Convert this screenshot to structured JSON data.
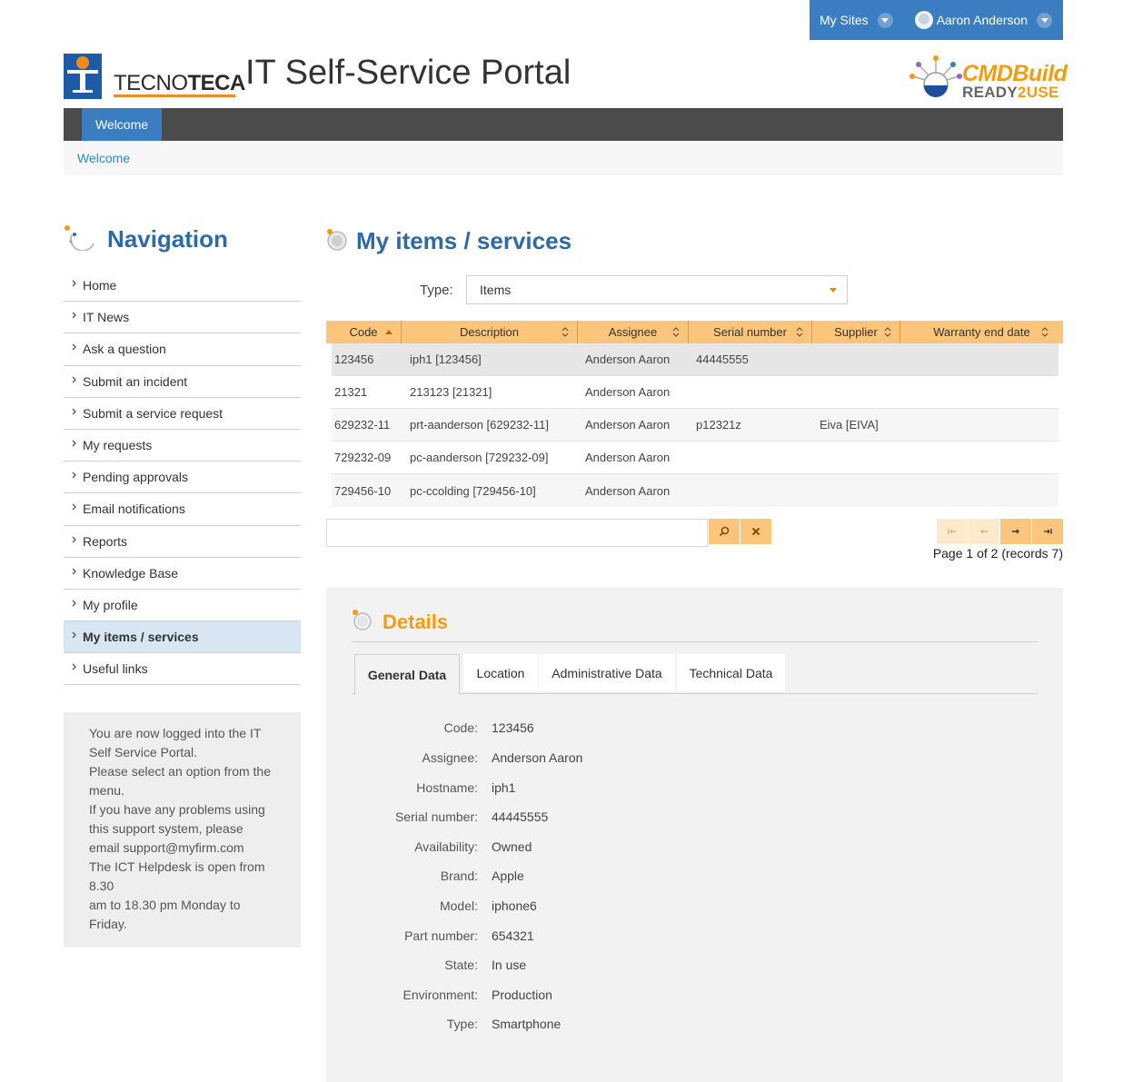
{
  "topbar": {
    "my_sites": "My Sites",
    "user_name": "Aaron Anderson"
  },
  "header": {
    "logo_text_a": "TECNO",
    "logo_text_b": "TECA",
    "portal_title": "IT Self-Service Portal",
    "cmdbuild_title": "CMDBuild",
    "cmdbuild_sub_a": "READY",
    "cmdbuild_sub_b": "2USE"
  },
  "navbar": {
    "active_tab": "Welcome"
  },
  "breadcrumb": "Welcome",
  "sidebar": {
    "title": "Navigation",
    "items": [
      {
        "label": "Home"
      },
      {
        "label": "IT News"
      },
      {
        "label": "Ask a question"
      },
      {
        "label": "Submit an incident"
      },
      {
        "label": "Submit a service request"
      },
      {
        "label": "My requests"
      },
      {
        "label": "Pending approvals"
      },
      {
        "label": "Email notifications"
      },
      {
        "label": "Reports"
      },
      {
        "label": "Knowledge Base"
      },
      {
        "label": "My profile"
      },
      {
        "label": "My items / services"
      },
      {
        "label": "Useful links"
      }
    ],
    "info_lines": [
      "You are now logged into the IT",
      "Self Service Portal.",
      "Please select an option from the",
      "menu.",
      "If you have any problems using",
      "this support system, please",
      "email support@myfirm.com",
      "The ICT Helpdesk is open from",
      "8.30",
      "am to 18.30 pm Monday to",
      "Friday."
    ]
  },
  "main": {
    "title": "My items / services",
    "type_label": "Type:",
    "type_value": "Items",
    "columns": [
      "Code",
      "Description",
      "Assignee",
      "Serial number",
      "Supplier",
      "Warranty end date"
    ],
    "rows": [
      [
        "123456",
        "iph1 [123456]",
        "Anderson Aaron",
        "44445555",
        "",
        ""
      ],
      [
        "21321",
        "213123 [21321]",
        "Anderson Aaron",
        "",
        "",
        ""
      ],
      [
        "629232-11",
        "prt-aanderson [629232-11]",
        "Anderson Aaron",
        "p12321z",
        "Eiva [EIVA]",
        ""
      ],
      [
        "729232-09",
        "pc-aanderson [729232-09]",
        "Anderson Aaron",
        "",
        "",
        ""
      ],
      [
        "729456-10",
        "pc-ccolding [729456-10]",
        "Anderson Aaron",
        "",
        "",
        ""
      ]
    ],
    "page_info": "Page 1 of 2 (records 7)"
  },
  "details": {
    "title": "Details",
    "tabs": [
      "General Data",
      "Location",
      "Administrative Data",
      "Technical Data"
    ],
    "fields": [
      {
        "label": "Code:",
        "value": "123456"
      },
      {
        "label": "Assignee:",
        "value": "Anderson Aaron"
      },
      {
        "label": "Hostname:",
        "value": "iph1"
      },
      {
        "label": "Serial number:",
        "value": "44445555"
      },
      {
        "label": "Availability:",
        "value": "Owned"
      },
      {
        "label": "Brand:",
        "value": "Apple"
      },
      {
        "label": "Model:",
        "value": "iphone6"
      },
      {
        "label": "Part number:",
        "value": "654321"
      },
      {
        "label": "State:",
        "value": "In use"
      },
      {
        "label": "Environment:",
        "value": "Production"
      },
      {
        "label": "Type:",
        "value": "Smartphone"
      }
    ]
  },
  "colors": {
    "primary_blue": "#3a7dc1",
    "heading_blue": "#2d6aa6",
    "accent_orange": "#f39c12",
    "grid_header": "#fbc67b",
    "navbar_dark": "#4b4b4b"
  },
  "icons": {
    "topbar_caret": "chevron-down-icon",
    "section": "orbit-icon",
    "sort": "sort-icon",
    "search": "search-icon",
    "clear": "close-icon"
  }
}
